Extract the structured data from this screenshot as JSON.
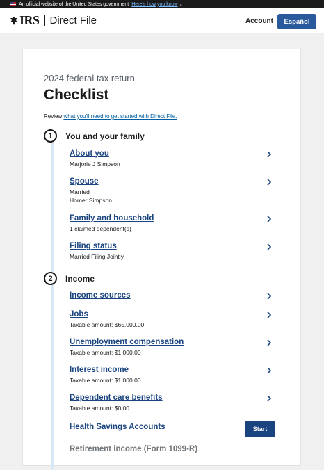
{
  "banner": {
    "text": "An official website of the United States government",
    "link": "Here's how you know"
  },
  "header": {
    "logo_text": "IRS",
    "app_name": "Direct File",
    "account_label": "Account",
    "language_button": "Español"
  },
  "page": {
    "eyebrow": "2024 federal tax return",
    "title": "Checklist",
    "intro_prefix": "Review ",
    "intro_link": "what you'll need to get started with Direct File."
  },
  "sections": [
    {
      "number": "1",
      "title": "You and your family",
      "items": [
        {
          "label": "About you",
          "sub": [
            "Marjorie J Simpson"
          ]
        },
        {
          "label": "Spouse",
          "sub": [
            "Married",
            "Homer Simpson"
          ]
        },
        {
          "label": "Family and household",
          "sub": [
            "1 claimed dependent(s)"
          ]
        },
        {
          "label": "Filing status",
          "sub": [
            "Married Filing Jointly"
          ]
        }
      ]
    },
    {
      "number": "2",
      "title": "Income",
      "items": [
        {
          "label": "Income sources",
          "sub": []
        },
        {
          "label": "Jobs",
          "sub": [
            "Taxable amount: $65,000.00"
          ]
        },
        {
          "label": "Unemployment compensation",
          "sub": [
            "Taxable amount: $1,000.00"
          ]
        },
        {
          "label": "Interest income",
          "sub": [
            "Taxable amount: $1,000.00"
          ]
        },
        {
          "label": "Dependent care benefits",
          "sub": [
            "Taxable amount: $0.00"
          ]
        },
        {
          "label": "Health Savings Accounts",
          "action": "Start"
        },
        {
          "label": "Retirement income (Form 1099-R)",
          "disabled": true
        }
      ]
    }
  ],
  "colors": {
    "link": "#1a4480",
    "button": "#1a4480",
    "rail": "#d9e8f6"
  },
  "icons": [
    "us-flag-icon",
    "irs-eagle-icon",
    "chevron-right-icon",
    "chevron-down-icon"
  ]
}
